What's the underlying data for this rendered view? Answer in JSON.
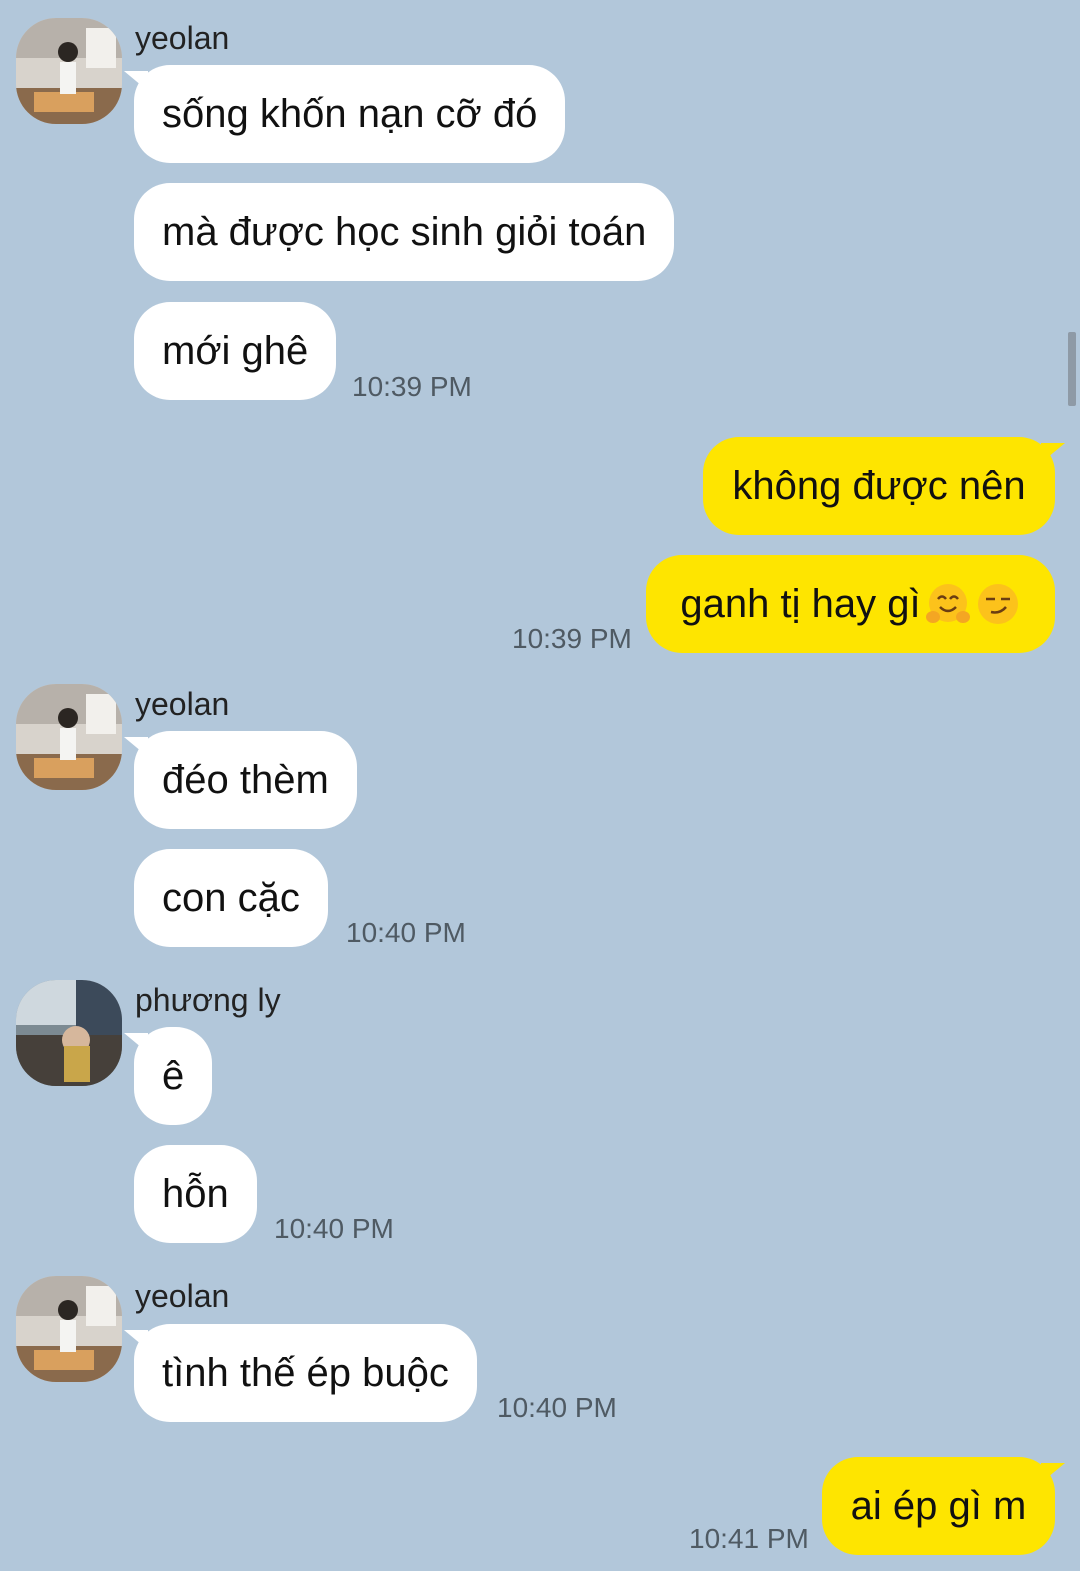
{
  "messages": [
    {
      "sender": "yeolan",
      "bubbles": [
        "sống khốn nạn cỡ đó",
        "mà được học sinh giỏi toán",
        "mới ghê"
      ],
      "time": "10:39 PM"
    },
    {
      "outgoing": true,
      "bubbles": [
        "không được nên",
        "ganh tị hay gì"
      ],
      "time": "10:39 PM"
    },
    {
      "sender": "yeolan",
      "bubbles": [
        "đéo thèm",
        "con cặc"
      ],
      "time": "10:40 PM"
    },
    {
      "sender": "phương ly",
      "bubbles": [
        "ê",
        "hỗn"
      ],
      "time": "10:40 PM"
    },
    {
      "sender": "yeolan",
      "bubbles": [
        "tình thế ép buộc"
      ],
      "time": "10:40 PM"
    },
    {
      "outgoing": true,
      "bubbles": [
        "ai ép gì m"
      ],
      "time": "10:41 PM"
    }
  ],
  "emoji_icons": [
    "hugging-face-emoji",
    "smirking-face-emoji"
  ],
  "colors": {
    "background": "#b2c7da",
    "incoming_bubble": "#ffffff",
    "outgoing_bubble": "#fee500",
    "timestamp": "#4f5a63"
  }
}
